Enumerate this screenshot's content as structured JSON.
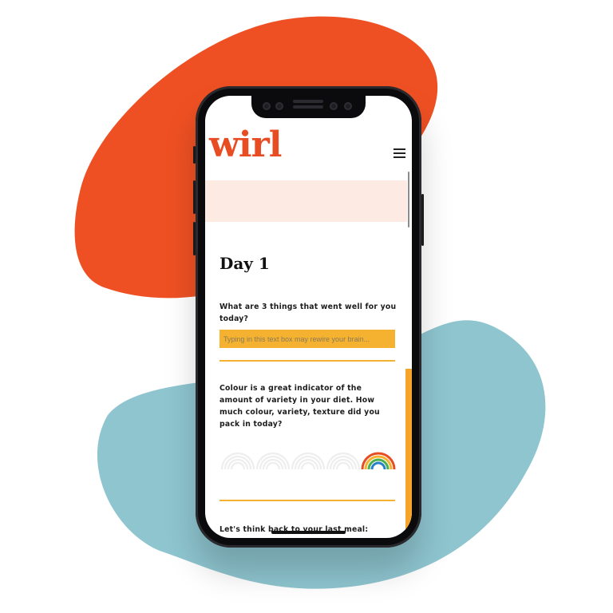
{
  "app": {
    "logo_text": "wirl",
    "brand_color": "#e84c22",
    "accent_color": "#f5b231",
    "banner_color": "#fdebe3"
  },
  "background": {
    "blob_top_color": "#ee5023",
    "blob_bottom_color": "#8ec5cf"
  },
  "header": {
    "menu_icon": "hamburger-menu-icon"
  },
  "page": {
    "title": "Day 1",
    "question_1": "What are 3 things that went well for you today?",
    "input_placeholder": "Typing in this text box may rewire your brain...",
    "question_2": "Colour is a great indicator of the amount of variety in your diet. How much colour, variety, texture did you pack in today?",
    "rainbow_rating": {
      "max": 5,
      "value": 5,
      "selected_index": 4
    },
    "question_3": "Let's think back to your last meal:"
  }
}
